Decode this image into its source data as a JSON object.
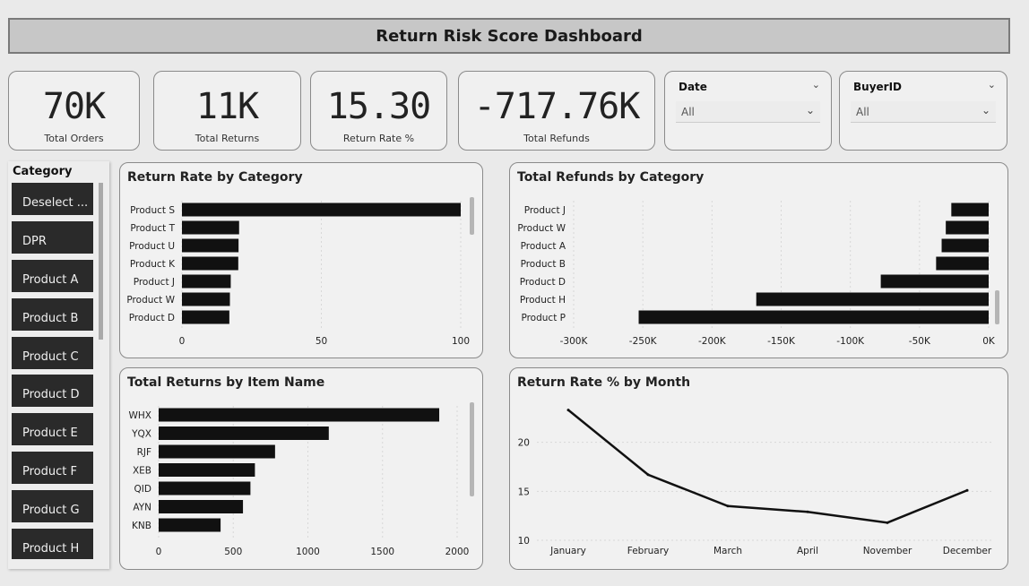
{
  "header": {
    "title": "Return Risk Score Dashboard"
  },
  "kpis": [
    {
      "value": "70K",
      "label": "Total Orders"
    },
    {
      "value": "11K",
      "label": "Total Returns"
    },
    {
      "value": "15.30",
      "label": "Return Rate %"
    },
    {
      "value": "-717.76K",
      "label": "Total Refunds"
    }
  ],
  "slicers": {
    "date": {
      "title": "Date",
      "value": "All"
    },
    "buyer": {
      "title": "BuyerID",
      "value": "All"
    }
  },
  "category_slicer": {
    "title": "Category",
    "items": [
      "Deselect ...",
      "DPR",
      "Product A",
      "Product B",
      "Product C",
      "Product D",
      "Product E",
      "Product F",
      "Product G",
      "Product H"
    ]
  },
  "icons": {
    "dropdown": "chevron-down-icon"
  },
  "colors": {
    "bar": "#111111",
    "line": "#111111",
    "panel": "#f1f1f1"
  },
  "chart_data": [
    {
      "type": "bar",
      "orientation": "horizontal",
      "title": "Return Rate by Category",
      "categories": [
        "Product S",
        "Product T",
        "Product U",
        "Product K",
        "Product J",
        "Product W",
        "Product D"
      ],
      "values": [
        100,
        20.5,
        20.3,
        20.2,
        17.5,
        17.2,
        17.0
      ],
      "xlim": [
        0,
        100
      ],
      "xticks": [
        "0",
        "50",
        "100"
      ]
    },
    {
      "type": "bar",
      "orientation": "horizontal",
      "title": "Total Refunds by Category",
      "categories": [
        "Product J",
        "Product W",
        "Product A",
        "Product B",
        "Product D",
        "Product H",
        "Product P"
      ],
      "values": [
        -27000,
        -31000,
        -34000,
        -38000,
        -78000,
        -168000,
        -253000
      ],
      "xlim": [
        -300000,
        0
      ],
      "xticks": [
        "-300K",
        "-250K",
        "-200K",
        "-150K",
        "-100K",
        "-50K",
        "0K"
      ]
    },
    {
      "type": "bar",
      "orientation": "horizontal",
      "title": "Total Returns by Item Name",
      "categories": [
        "WHX",
        "YQX",
        "RJF",
        "XEB",
        "QID",
        "AYN",
        "KNB"
      ],
      "values": [
        1880,
        1140,
        780,
        645,
        615,
        565,
        415
      ],
      "xlim": [
        0,
        2000
      ],
      "xticks": [
        "0",
        "500",
        "1000",
        "1500",
        "2000"
      ]
    },
    {
      "type": "line",
      "title": "Return Rate % by Month",
      "categories": [
        "January",
        "February",
        "March",
        "April",
        "November",
        "December"
      ],
      "values": [
        23.3,
        16.7,
        13.5,
        12.9,
        11.8,
        15.1
      ],
      "ylim": [
        10,
        25
      ],
      "yticks": [
        "10",
        "15",
        "20"
      ]
    }
  ]
}
